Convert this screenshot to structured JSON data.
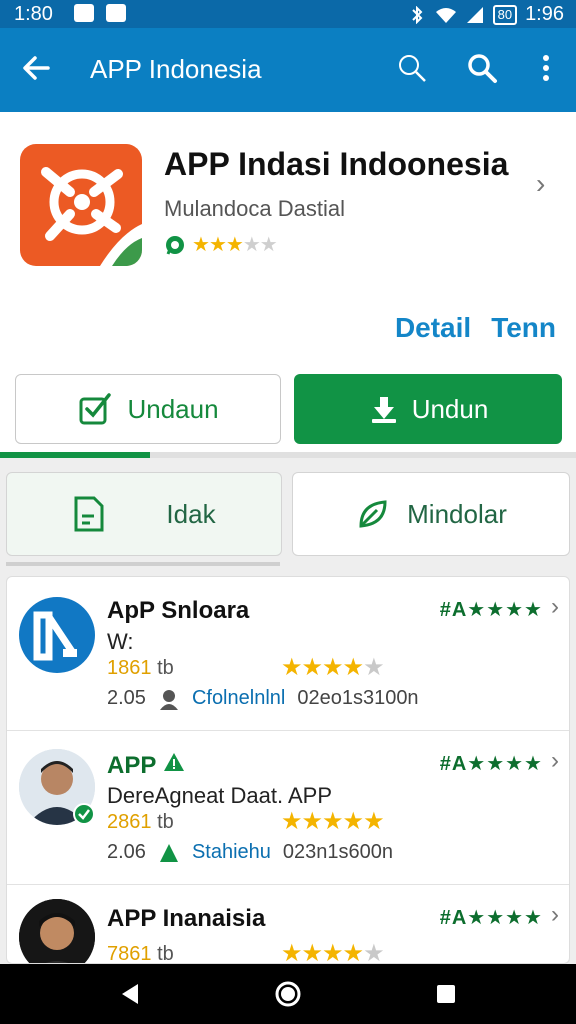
{
  "status": {
    "time_left": "1:80",
    "time_right": "1:96",
    "battery": "80"
  },
  "appbar": {
    "title": "APP Indonesia",
    "icons": [
      "back-arrow-icon",
      "search-outline-icon",
      "search-icon",
      "more-vert-icon"
    ]
  },
  "header": {
    "app_name": "APP Indasi Indoonesia",
    "developer": "Mulandoca Dastial",
    "rating": 3,
    "rating_max": 5,
    "links": [
      "Detail",
      "Tenn"
    ]
  },
  "actions": {
    "secondary_label": "Undaun",
    "primary_label": "Undun",
    "progress": 0.26
  },
  "tabs": {
    "left_label": "Idak",
    "right_label": "Mindolar"
  },
  "list": [
    {
      "name": "ApP Snloara",
      "subtitle": "W:",
      "size_num": "1861",
      "size_unit": "tb",
      "stars": 4,
      "date": "2.05",
      "link": "Cfolnelnlnl",
      "extra": "02eo1s3100n",
      "tag": "#A★★★★",
      "avatar": "logo"
    },
    {
      "name": "APP",
      "subtitle": "DereAgneat Daat. APP",
      "size_num": "2861",
      "size_unit": "tb",
      "stars": 5,
      "date": "2.06",
      "link": "Stahiehu",
      "extra": "023n1s600n",
      "tag": "#A★★★★",
      "avatar": "man1"
    },
    {
      "name": "APP Inanaisia",
      "subtitle": "",
      "size_num": "7861",
      "size_unit": "tb",
      "stars": 4,
      "date": "",
      "link": "",
      "extra": "",
      "tag": "#A★★★★",
      "avatar": "man2"
    }
  ],
  "colors": {
    "appbar": "#0b7fc2",
    "status": "#0b69a8",
    "green": "#119345",
    "link_blue": "#1486c8",
    "logo_orange": "#ec5a24"
  }
}
